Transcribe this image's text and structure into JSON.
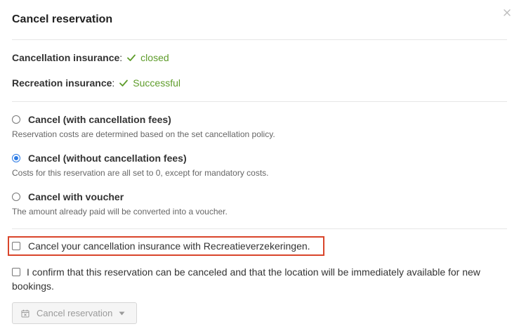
{
  "modal": {
    "title": "Cancel reservation"
  },
  "insurance": {
    "cancellation_label": "Cancellation insurance",
    "cancellation_status": "closed",
    "recreation_label": "Recreation insurance",
    "recreation_status": "Successful",
    "separator": ":",
    "status_color": "#5e9c2a"
  },
  "options": [
    {
      "label": "Cancel (with cancellation fees)",
      "description": "Reservation costs are determined based on the set cancellation policy.",
      "selected": false
    },
    {
      "label": "Cancel (without cancellation fees)",
      "description": "Costs for this reservation are all set to 0, except for mandatory costs.",
      "selected": true
    },
    {
      "label": "Cancel with voucher",
      "description": "The amount already paid will be converted into a voucher.",
      "selected": false
    }
  ],
  "checkboxes": {
    "cancel_insurance": "Cancel your cancellation insurance with Recreatieverzekeringen.",
    "confirm": "I confirm that this reservation can be canceled and that the location will be immediately available for new bookings."
  },
  "actions": {
    "cancel_button": "Cancel reservation"
  },
  "colors": {
    "accent": "#2c7be5",
    "highlight": "#d9452b"
  },
  "icons": {
    "close": "close-icon",
    "status": "checkmark-icon",
    "button": "calendar-x-icon",
    "dropdown": "caret-down-icon"
  }
}
